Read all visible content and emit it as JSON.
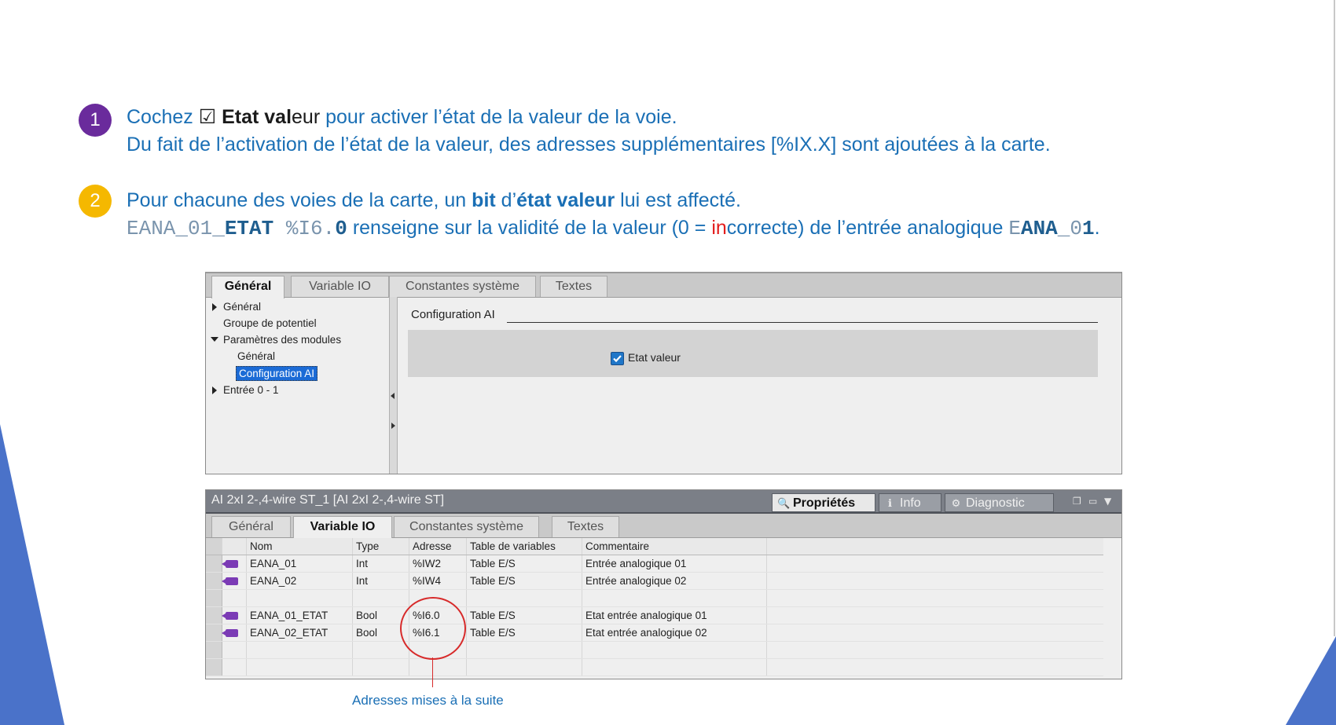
{
  "step1": {
    "number": "1",
    "line1_a": "Cochez ",
    "line1_checkbox": "☑",
    "line1_bold": " Etat val",
    "line1_rest": "eur",
    "line1_b": " pour activer l’état de la valeur de la voie.",
    "line2": "Du fait de l’activation de l’état de la valeur,  des adresses supplémentaires [%IX.X] sont ajoutées à la carte."
  },
  "step2": {
    "number": "2",
    "line1_a": "Pour chacune des voies de la carte, un ",
    "line1_bit": "bit",
    "line1_b": " d’",
    "line1_etat": "état valeur",
    "line1_c": " lui est affecté.",
    "code_var1": "EANA_01_",
    "code_var1_bold": "ETAT",
    "code_addr1": " %I6.",
    "code_addr1_bold": "0",
    "line2_a": " renseigne sur la validité de la valeur (0 = ",
    "line2_red": "in",
    "line2_b": "correcte) de l’entrée analogique ",
    "code_var2_a": "E",
    "code_var2_bold": "ANA",
    "code_var2_b": "_0",
    "code_var2_bold2": "1",
    "line2_end": "."
  },
  "panel1": {
    "tabs": [
      "Général",
      "Variable IO",
      "Constantes système",
      "Textes"
    ],
    "active_tab": "Général",
    "tree": [
      "Général",
      "Groupe de potentiel",
      "Paramètres des modules",
      "Général",
      "Configuration AI",
      "Entrée 0 - 1"
    ],
    "section_title": "Configuration AI",
    "checkbox_label": "Etat valeur",
    "checkbox_checked": true
  },
  "panel2": {
    "title": "AI 2xI 2-,4-wire ST_1 [AI 2xI 2-,4-wire ST]",
    "prop_tabs": [
      "Propriétés",
      "Info",
      "Diagnostic"
    ],
    "active_prop_tab": "Propriétés",
    "tabs": [
      "Général",
      "Variable IO",
      "Constantes système",
      "Textes"
    ],
    "active_tab": "Variable IO",
    "columns": [
      "Nom",
      "Type",
      "Adresse",
      "Table de variables",
      "Commentaire"
    ],
    "rows": [
      {
        "name": "EANA_01",
        "type": "Int",
        "address": "%IW2",
        "table": "Table E/S",
        "comment": "Entrée analogique 01"
      },
      {
        "name": "EANA_02",
        "type": "Int",
        "address": "%IW4",
        "table": "Table E/S",
        "comment": "Entrée analogique 02"
      },
      {
        "name": "",
        "type": "",
        "address": "",
        "table": "",
        "comment": ""
      },
      {
        "name": "EANA_01_ETAT",
        "type": "Bool",
        "address": "%I6.0",
        "table": "Table E/S",
        "comment": "Etat entrée analogique 01"
      },
      {
        "name": "EANA_02_ETAT",
        "type": "Bool",
        "address": "%I6.1",
        "table": "Table E/S",
        "comment": "Etat entrée analogique 02"
      },
      {
        "name": "",
        "type": "",
        "address": "",
        "table": "",
        "comment": ""
      },
      {
        "name": "",
        "type": "",
        "address": "",
        "table": "",
        "comment": ""
      }
    ]
  },
  "caption": "Adresses mises à la suite",
  "colors": {
    "accent_blue": "#1a6fb5",
    "bullet1": "#6a2b9c",
    "bullet2": "#f5b800",
    "highlight_red": "#d72a2a"
  }
}
